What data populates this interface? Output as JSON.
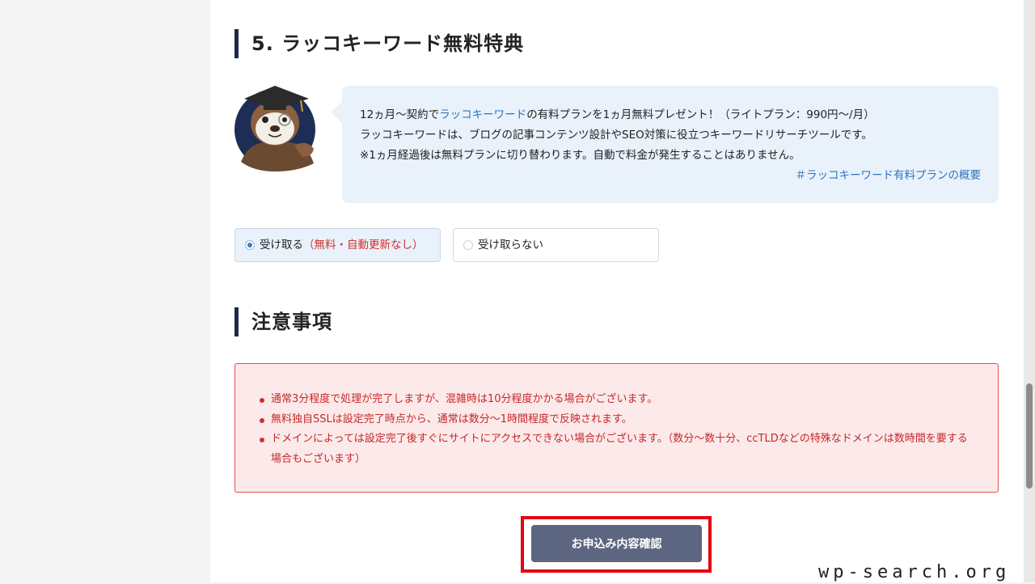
{
  "sections": {
    "campaign_title": "5. ラッコキーワード無料特典",
    "notes_title": "注意事項"
  },
  "campaign": {
    "line1_prefix": "12ヵ月〜契約で",
    "line1_link": "ラッコキーワード",
    "line1_suffix": "の有料プランを1ヵ月無料プレゼント！（ライトプラン：990円〜/月）",
    "line2": "ラッコキーワードは、ブログの記事コンテンツ設計やSEO対策に役立つキーワードリサーチツールです。",
    "line3": "※1ヵ月経過後は無料プランに切り替わります。自動で料金が発生することはありません。",
    "overview_link": "＃ラッコキーワード有料プランの概要"
  },
  "options": {
    "receive_label": "受け取る",
    "receive_note": "（無料・自動更新なし）",
    "decline_label": "受け取らない",
    "selected": "receive"
  },
  "notes": [
    "通常3分程度で処理が完了しますが、混雑時は10分程度かかる場合がございます。",
    "無料独自SSLは設定完了時点から、通常は数分〜1時間程度で反映されます。",
    "ドメインによっては設定完了後すぐにサイトにアクセスできない場合がございます。（数分〜数十分、ccTLDなどの特殊なドメインは数時間を要する場合もございます）"
  ],
  "confirm_button": "お申込み内容確認",
  "watermark": "wp-search.org",
  "colors": {
    "title_bar": "#1c2a4a",
    "link": "#2f74c0",
    "bubble_bg": "#e9f1fb",
    "notice_bg": "#fce9ea",
    "notice_text": "#c62828",
    "button_bg": "#5c6680",
    "highlight": "#e60012"
  },
  "icons": {
    "mascot": "sea-otter-mascot-icon"
  }
}
